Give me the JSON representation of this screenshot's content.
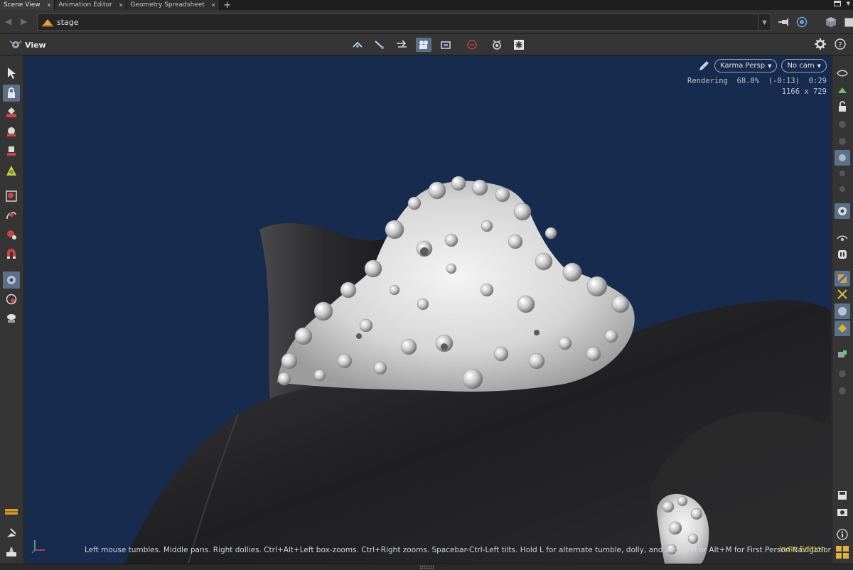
{
  "tabs": [
    {
      "label": "Scene View",
      "active": true
    },
    {
      "label": "Animation Editor",
      "active": false
    },
    {
      "label": "Geometry Spreadsheet",
      "active": false
    }
  ],
  "tab_add_label": "+",
  "path": {
    "value": "stage"
  },
  "viewer": {
    "label": "View"
  },
  "hud": {
    "renderer": "Karma Persp",
    "camera": "No cam",
    "render_status": "Rendering  68.0%  (-0:13)  0:29",
    "resolution": "1166 x 729"
  },
  "status_hint": "Left mouse tumbles. Middle pans. Right dollies. Ctrl+Alt+Left box-zooms. Ctrl+Right zooms. Spacebar-Ctrl-Left tilts. Hold L for alternate tumble, dolly, and zoom.     M or Alt+M for First Person Navigation.",
  "edition": "Indie Edition",
  "icons": {
    "left_toolbar": [
      "select-icon",
      "view-lock-icon",
      "move-icon",
      "rotate-icon",
      "scale-icon",
      "handle-icon",
      "box-select-icon",
      "lasso-icon",
      "paint-icon",
      "magnet-icon",
      "snap-icon",
      "pose-icon",
      "light-icon",
      "timeline-icon",
      "brush-icon",
      "stamp-icon"
    ],
    "right_toolbar": [
      "display-icon",
      "ghost-icon",
      "lock-icon",
      "camera-lock-icon",
      "dot-icon",
      "geo-icon",
      "light-link-icon",
      "pin-icon",
      "vis-icon",
      "eye-icon",
      "pause-icon",
      "shading-icon",
      "texture-icon",
      "sphere-icon",
      "vertex-icon",
      "layout-icon",
      "save-icon",
      "info-icon",
      "grid-icon"
    ]
  },
  "colors": {
    "viewport_bg": "#172b4f",
    "selected_tool": "#5b7189",
    "edition_text": "#d9bf35"
  }
}
